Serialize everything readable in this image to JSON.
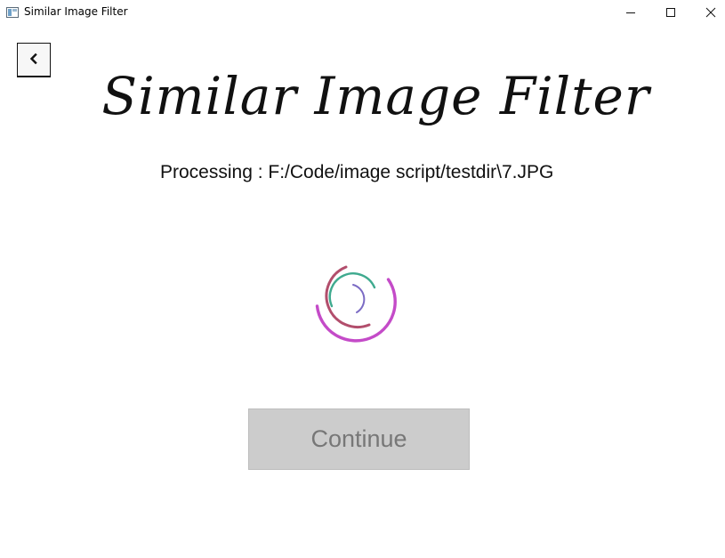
{
  "window": {
    "title": "Similar Image Filter",
    "controls": {
      "minimize_icon": "minimize-icon",
      "maximize_icon": "maximize-icon",
      "close_icon": "close-icon"
    }
  },
  "nav": {
    "back_icon": "chevron-left-icon"
  },
  "main": {
    "heading": "Similar Image Filter",
    "processing_text": "Processing : F:/Code/image script/testdir\\7.JPG",
    "continue_label": "Continue",
    "continue_enabled": false
  },
  "spinner": {
    "colors": {
      "outer": "#c44bc8",
      "middle": "#b24e6c",
      "inner": "#3faa8f",
      "core": "#7b6bc4"
    }
  }
}
